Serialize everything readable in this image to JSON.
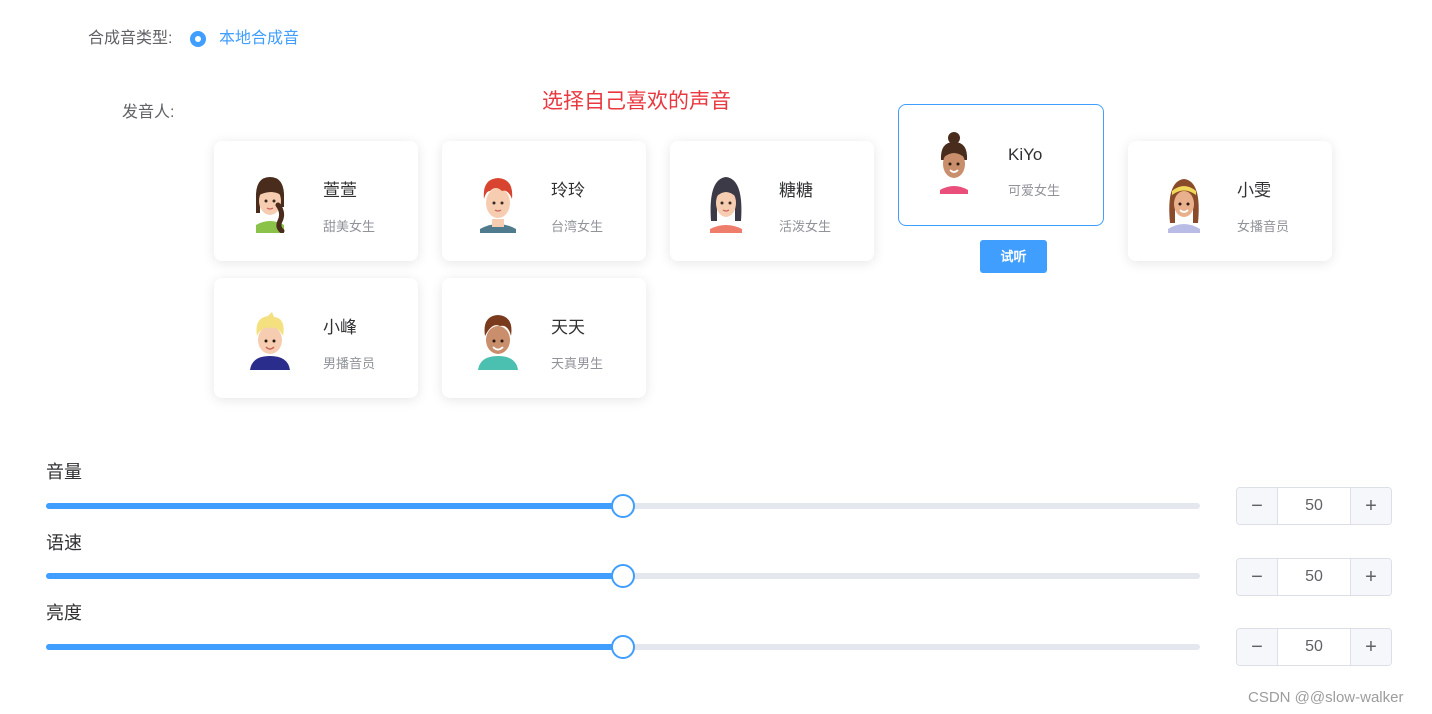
{
  "synthesis_type": {
    "label": "合成音类型:",
    "option_label": "本地合成音"
  },
  "speaker": {
    "label": "发音人:",
    "hint": "选择自己喜欢的声音",
    "listen_label": "试听",
    "voices": [
      {
        "name": "萱萱",
        "desc": "甜美女生",
        "icon": "girl-braid-avatar-icon"
      },
      {
        "name": "玲玲",
        "desc": "台湾女生",
        "icon": "girl-redhair-avatar-icon"
      },
      {
        "name": "糖糖",
        "desc": "活泼女生",
        "icon": "girl-darkhair-avatar-icon"
      },
      {
        "name": "KiYo",
        "desc": "可爱女生",
        "icon": "girl-bun-avatar-icon",
        "selected": true
      },
      {
        "name": "小雯",
        "desc": "女播音员",
        "icon": "girl-headband-avatar-icon"
      },
      {
        "name": "小峰",
        "desc": "男播音员",
        "icon": "boy-blonde-avatar-icon"
      },
      {
        "name": "天天",
        "desc": "天真男生",
        "icon": "boy-brownhair-avatar-icon"
      }
    ]
  },
  "sliders": [
    {
      "label": "音量",
      "value": 50,
      "min": 0,
      "max": 100
    },
    {
      "label": "语速",
      "value": 50,
      "min": 0,
      "max": 100
    },
    {
      "label": "亮度",
      "value": 50,
      "min": 0,
      "max": 100
    }
  ],
  "stepper": {
    "decrement": "−",
    "increment": "+"
  },
  "watermark": "CSDN @@slow-walker",
  "colors": {
    "accent": "#409eff",
    "hint": "#e9383f"
  }
}
